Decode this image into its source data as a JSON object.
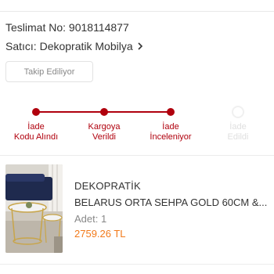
{
  "order": {
    "delivery_label": "Teslimat No:",
    "delivery_number": "9018114877",
    "seller_label": "Satıcı:",
    "seller_name": "Dekopratik Mobilya",
    "follow_button": "Takip Ediliyor"
  },
  "progress": {
    "accent_color": "#b0000d",
    "steps": [
      {
        "line1": "İade",
        "line2": "Kodu Alındı",
        "state": "done"
      },
      {
        "line1": "Kargoya",
        "line2": "Verildi",
        "state": "done"
      },
      {
        "line1": "İade",
        "line2": "İnceleniyor",
        "state": "current"
      },
      {
        "line1": "İade",
        "line2": "Edildi",
        "state": "pending"
      }
    ]
  },
  "product": {
    "brand": "DEKOPRATİK",
    "name": "BELARUS ORTA SEHPA GOLD 60CM &...",
    "qty_label": "Adet:",
    "qty_value": "1",
    "price": "2759.26 TL",
    "price_color": "#f27a1a",
    "image_icon": "coffee-table-photo"
  }
}
